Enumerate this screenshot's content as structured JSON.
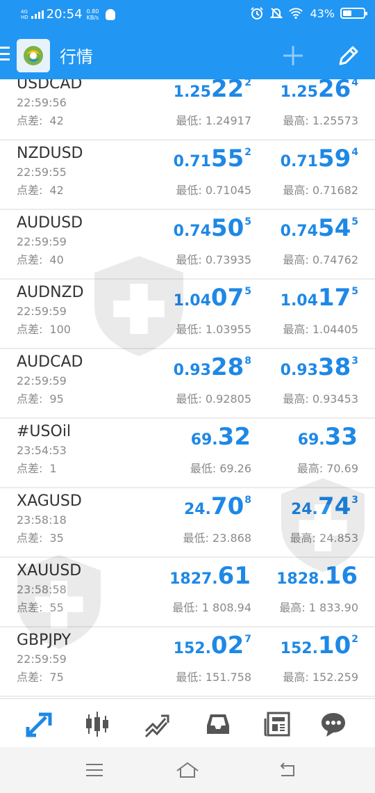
{
  "status_bar": {
    "network": "4G",
    "network_sub": "HD",
    "time": "20:54",
    "speed_value": "0.80",
    "speed_unit": "KB/s",
    "battery": "43%",
    "battery_level": 0.43
  },
  "app_bar": {
    "title": "行情",
    "accent_color": "#2196f3"
  },
  "labels": {
    "spread": "点差:",
    "low": "最低:",
    "high": "最高:"
  },
  "quotes": [
    {
      "symbol": "USDCAD",
      "time": "22:59:56",
      "spread": "42",
      "bid": {
        "pre": "1.25",
        "big": "22",
        "sup": "2"
      },
      "ask": {
        "pre": "1.25",
        "big": "26",
        "sup": "4"
      },
      "low": "1.24917",
      "high": "1.25573"
    },
    {
      "symbol": "NZDUSD",
      "time": "22:59:55",
      "spread": "42",
      "bid": {
        "pre": "0.71",
        "big": "55",
        "sup": "2"
      },
      "ask": {
        "pre": "0.71",
        "big": "59",
        "sup": "4"
      },
      "low": "0.71045",
      "high": "0.71682"
    },
    {
      "symbol": "AUDUSD",
      "time": "22:59:59",
      "spread": "40",
      "bid": {
        "pre": "0.74",
        "big": "50",
        "sup": "5"
      },
      "ask": {
        "pre": "0.74",
        "big": "54",
        "sup": "5"
      },
      "low": "0.73935",
      "high": "0.74762"
    },
    {
      "symbol": "AUDNZD",
      "time": "22:59:59",
      "spread": "100",
      "bid": {
        "pre": "1.04",
        "big": "07",
        "sup": "5"
      },
      "ask": {
        "pre": "1.04",
        "big": "17",
        "sup": "5"
      },
      "low": "1.03955",
      "high": "1.04405"
    },
    {
      "symbol": "AUDCAD",
      "time": "22:59:59",
      "spread": "95",
      "bid": {
        "pre": "0.93",
        "big": "28",
        "sup": "8"
      },
      "ask": {
        "pre": "0.93",
        "big": "38",
        "sup": "3"
      },
      "low": "0.92805",
      "high": "0.93453"
    },
    {
      "symbol": "#USOil",
      "time": "23:54:53",
      "spread": "1",
      "bid": {
        "pre": "69.",
        "big": "32",
        "sup": ""
      },
      "ask": {
        "pre": "69.",
        "big": "33",
        "sup": ""
      },
      "low": "69.26",
      "high": "70.69"
    },
    {
      "symbol": "XAGUSD",
      "time": "23:58:18",
      "spread": "35",
      "bid": {
        "pre": "24.",
        "big": "70",
        "sup": "8"
      },
      "ask": {
        "pre": "24.",
        "big": "74",
        "sup": "3"
      },
      "low": "23.868",
      "high": "24.853"
    },
    {
      "symbol": "XAUUSD",
      "time": "23:58:58",
      "spread": "55",
      "bid": {
        "pre": "1827.",
        "big": "61",
        "sup": ""
      },
      "ask": {
        "pre": "1828.",
        "big": "16",
        "sup": ""
      },
      "low": "1 808.94",
      "high": "1 833.90"
    },
    {
      "symbol": "GBPJPY",
      "time": "22:59:59",
      "spread": "75",
      "bid": {
        "pre": "152.",
        "big": "02",
        "sup": "7"
      },
      "ask": {
        "pre": "152.",
        "big": "10",
        "sup": "2"
      },
      "low": "151.758",
      "high": "152.259"
    }
  ],
  "bottom_nav": {
    "icons": [
      "quotes-icon",
      "chart-icon",
      "trade-icon",
      "inbox-icon",
      "news-icon",
      "chat-icon"
    ],
    "active_color": "#1e88e5",
    "inactive_color": "#555555"
  }
}
